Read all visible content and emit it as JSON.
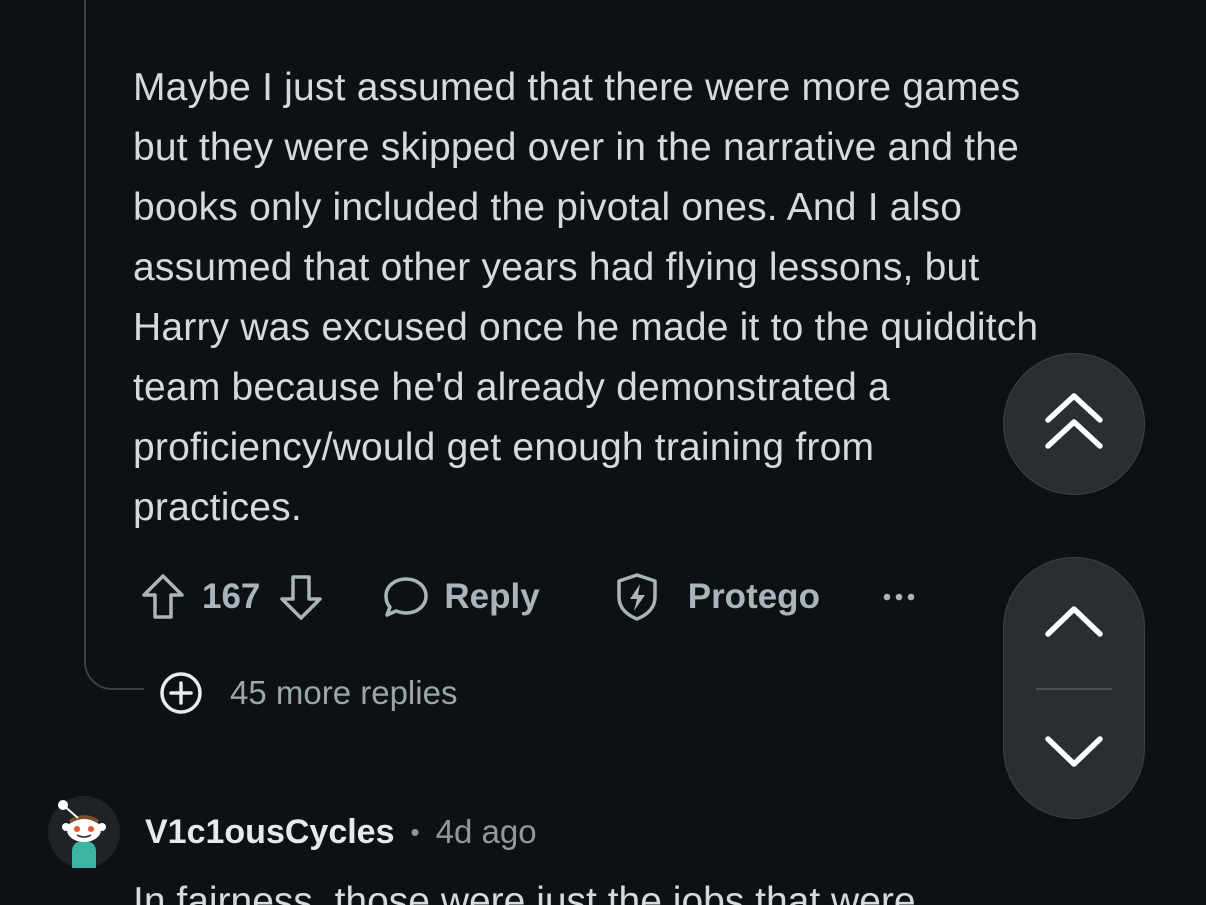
{
  "comment": {
    "body_lines": [
      "Maybe I just assumed that there were more games",
      "but they were skipped over in the narrative and the",
      "books only included the pivotal ones. And I also",
      "assumed that other years had flying lessons, but",
      "Harry was excused once he made it to the quidditch",
      "team because he'd already demonstrated a",
      "proficiency/would get enough training from",
      "practices."
    ],
    "score": "167",
    "reply_label": "Reply",
    "protego_label": "Protego",
    "more_label": "···"
  },
  "thread": {
    "more_replies_label": "45 more replies"
  },
  "next_comment": {
    "username": "V1c1ousCycles",
    "separator": "•",
    "timestamp": "4d ago",
    "body_start": "In fairness, those were just the jobs that were"
  },
  "icons": {
    "upvote": "arrow-up-outline-icon",
    "downvote": "arrow-down-outline-icon",
    "reply": "speech-bubble-icon",
    "protego": "shield-bolt-icon",
    "more_replies": "plus-circle-icon",
    "scroll_top": "double-chevron-up-icon",
    "prev": "chevron-up-icon",
    "next": "chevron-down-icon"
  },
  "colors": {
    "background": "#0e1113",
    "text": "#d4dadd",
    "muted": "#aab4bb",
    "fab": "#2a2e31"
  }
}
